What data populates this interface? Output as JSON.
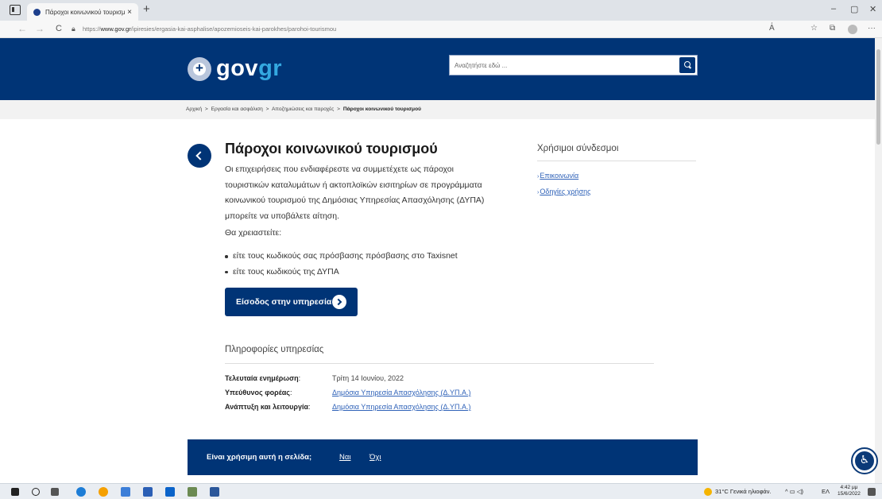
{
  "browser": {
    "tab_title": "Πάροχοι κοινωνικού τουρισμού",
    "tab_close": "×",
    "new_tab": "+",
    "url_prefix": "https://",
    "url_domain": "www.gov.gr",
    "url_path": "/ipiresies/ergasia-kai-asphalise/apozemioseis-kai-parokhes/parohoi-tourismou",
    "controls": {
      "minimize": "–",
      "restore": "▢",
      "close": "✕"
    },
    "nav": {
      "back": "←",
      "forward": "→",
      "reload": "C"
    },
    "toolbar": {
      "read_aloud": "A᷾",
      "favorites": "☆",
      "collections": "⧉",
      "more": "···"
    }
  },
  "header": {
    "logo_main": "gov",
    "logo_accent": "gr",
    "search_placeholder": "Αναζητήστε εδώ ..."
  },
  "breadcrumb": {
    "items": [
      "Αρχική",
      "Εργασία και ασφάλιση",
      "Αποζημιώσεις και παροχές"
    ],
    "separator": ">",
    "current": "Πάροχοι κοινωνικού τουρισμού"
  },
  "main": {
    "title": "Πάροχοι κοινωνικού τουρισμού",
    "intro": "Οι επιχειρήσεις που ενδιαφέρεστε να συμμετέχετε ως πάροχοι τουριστικών καταλυμάτων ή ακτοπλοϊκών εισιτηρίων σε προγράμματα κοινωνικού τουρισμού της Δημόσιας Υπηρεσίας Απασχόλησης (ΔΥΠΑ) μπορείτε να υποβάλετε αίτηση.",
    "needs_label": "Θα χρειαστείτε:",
    "requirements": [
      "είτε τους κωδικούς σας πρόσβασης πρόσβασης στο Taxisnet",
      "είτε τους κωδικούς της ΔΥΠΑ"
    ],
    "start_button": "Είσοδος στην υπηρεσία"
  },
  "service_info": {
    "heading": "Πληροφορίες υπηρεσίας",
    "rows": [
      {
        "label": "Τελευταία ενημέρωση",
        "value": "Τρίτη 14 Ιουνίου, 2022"
      },
      {
        "label": "Υπεύθυνος φορέας",
        "value": "Δημόσια Υπηρεσία Απασχόλησης (Δ.ΥΠ.Α.)"
      },
      {
        "label": "Ανάπτυξη και λειτουργία",
        "value": "Δημόσια Υπηρεσία Απασχόλησης (Δ.ΥΠ.Α.)"
      }
    ],
    "colon": ":"
  },
  "sidebar": {
    "heading": "Χρήσιμοι σύνδεσμοι",
    "links": [
      "Επικοινωνία",
      "Οδηγίες χρήσης"
    ],
    "chevron": "›"
  },
  "feedback": {
    "question": "Είναι χρήσιμη αυτή η σελίδα;",
    "yes": "Ναι",
    "no": "Όχι"
  },
  "taskbar": {
    "weather": "31°C Γενικά ηλιοφάν.",
    "lang": "ΕΛ",
    "time": "4:42 μμ",
    "date": "15/6/2022",
    "tray": "^ ▭ ◁)"
  },
  "colors": {
    "brand": "#003476",
    "accent": "#34a8e0",
    "link": "#2f62b8"
  }
}
